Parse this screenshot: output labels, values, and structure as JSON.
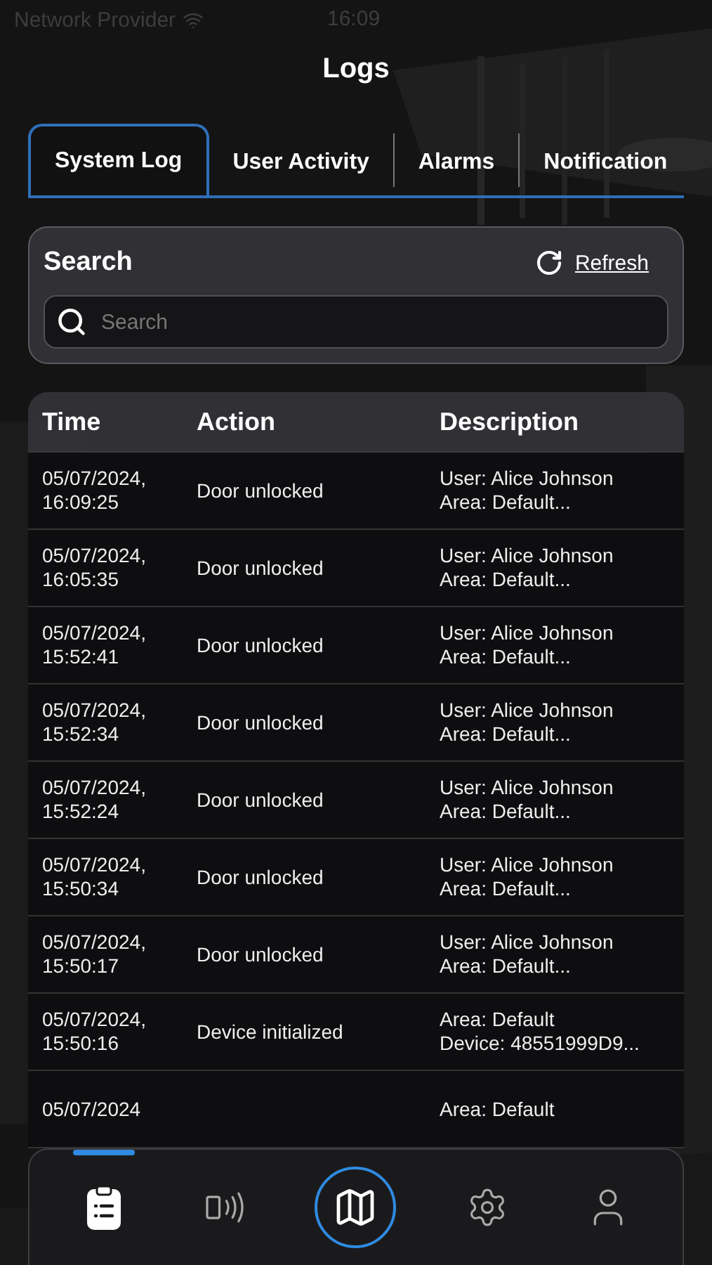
{
  "status_bar": {
    "carrier": "Network Provider",
    "time": "16:09"
  },
  "title": "Logs",
  "tabs": [
    {
      "label": "System Log",
      "selected": true
    },
    {
      "label": "User Activity",
      "selected": false
    },
    {
      "label": "Alarms",
      "selected": false
    },
    {
      "label": "Notification",
      "selected": false
    }
  ],
  "search": {
    "title": "Search",
    "refresh": "Refresh",
    "placeholder": "Search"
  },
  "table": {
    "columns": [
      "Time",
      "Action",
      "Description"
    ],
    "rows": [
      {
        "time": "05/07/2024,\n16:09:25",
        "action": "Door unlocked",
        "description": "User: Alice Johnson\nArea: Default..."
      },
      {
        "time": "05/07/2024,\n16:05:35",
        "action": "Door unlocked",
        "description": "User: Alice Johnson\nArea: Default..."
      },
      {
        "time": "05/07/2024,\n15:52:41",
        "action": "Door unlocked",
        "description": "User: Alice Johnson\nArea: Default..."
      },
      {
        "time": "05/07/2024,\n15:52:34",
        "action": "Door unlocked",
        "description": "User: Alice Johnson\nArea: Default..."
      },
      {
        "time": "05/07/2024,\n15:52:24",
        "action": "Door unlocked",
        "description": "User: Alice Johnson\nArea: Default..."
      },
      {
        "time": "05/07/2024,\n15:50:34",
        "action": "Door unlocked",
        "description": "User: Alice Johnson\nArea: Default..."
      },
      {
        "time": "05/07/2024,\n15:50:17",
        "action": "Door unlocked",
        "description": "User: Alice Johnson\nArea: Default..."
      },
      {
        "time": "05/07/2024,\n15:50:16",
        "action": "Device initialized",
        "description": "Area: Default\nDevice: 48551999D9..."
      },
      {
        "time": "05/07/2024",
        "description": "Area: Default"
      }
    ]
  },
  "nav": [
    {
      "kind": "plain",
      "selected": true
    },
    {
      "kind": "plain",
      "selected": false
    },
    {
      "kind": "center",
      "selected": false
    },
    {
      "kind": "plain",
      "selected": false
    },
    {
      "kind": "plain",
      "selected": false
    }
  ]
}
